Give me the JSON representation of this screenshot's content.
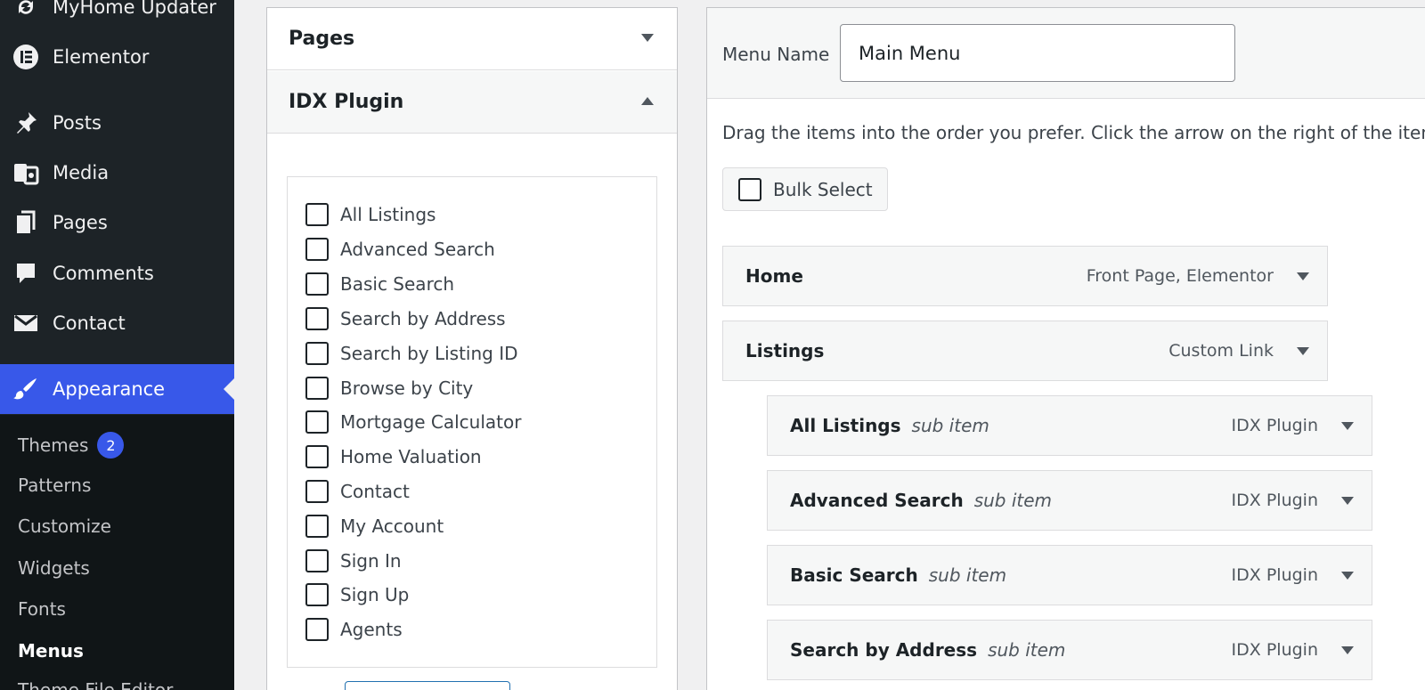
{
  "sidebar": {
    "top_items": [
      {
        "label": "MyHome Updater",
        "icon": "refresh-icon"
      },
      {
        "label": "Elementor",
        "icon": "elementor-icon"
      },
      {
        "label": "Posts",
        "icon": "pin-icon"
      },
      {
        "label": "Media",
        "icon": "media-icon"
      },
      {
        "label": "Pages",
        "icon": "pages-icon"
      },
      {
        "label": "Comments",
        "icon": "comment-icon"
      },
      {
        "label": "Contact",
        "icon": "envelope-icon"
      },
      {
        "label": "Appearance",
        "icon": "paintbrush-icon"
      }
    ],
    "submenu": [
      {
        "label": "Themes",
        "badge": "2"
      },
      {
        "label": "Patterns"
      },
      {
        "label": "Customize"
      },
      {
        "label": "Widgets"
      },
      {
        "label": "Fonts"
      },
      {
        "label": "Menus"
      },
      {
        "label": "Theme File Editor"
      }
    ]
  },
  "left_panel": {
    "pages_header": "Pages",
    "idx_header": "IDX Plugin",
    "checklist": [
      "All Listings",
      "Advanced Search",
      "Basic Search",
      "Search by Address",
      "Search by Listing ID",
      "Browse by City",
      "Mortgage Calculator",
      "Home Valuation",
      "Contact",
      "My Account",
      "Sign In",
      "Sign Up",
      "Agents"
    ]
  },
  "right_panel": {
    "menu_name_label": "Menu Name",
    "menu_name_value": "Main Menu",
    "instructions": "Drag the items into the order you prefer. Click the arrow on the right of the item",
    "bulk_select_label": "Bulk Select",
    "menu_items": [
      {
        "title": "Home",
        "sub": "",
        "type": "Front Page, Elementor"
      },
      {
        "title": "Listings",
        "sub": "",
        "type": "Custom Link"
      },
      {
        "title": "All Listings",
        "sub": "sub item",
        "type": "IDX Plugin"
      },
      {
        "title": "Advanced Search",
        "sub": "sub item",
        "type": "IDX Plugin"
      },
      {
        "title": "Basic Search",
        "sub": "sub item",
        "type": "IDX Plugin"
      },
      {
        "title": "Search by Address",
        "sub": "sub item",
        "type": "IDX Plugin"
      }
    ]
  },
  "colors": {
    "sidebar_bg": "#1d2327",
    "submenu_bg": "#101517",
    "accent": "#3858e9"
  }
}
